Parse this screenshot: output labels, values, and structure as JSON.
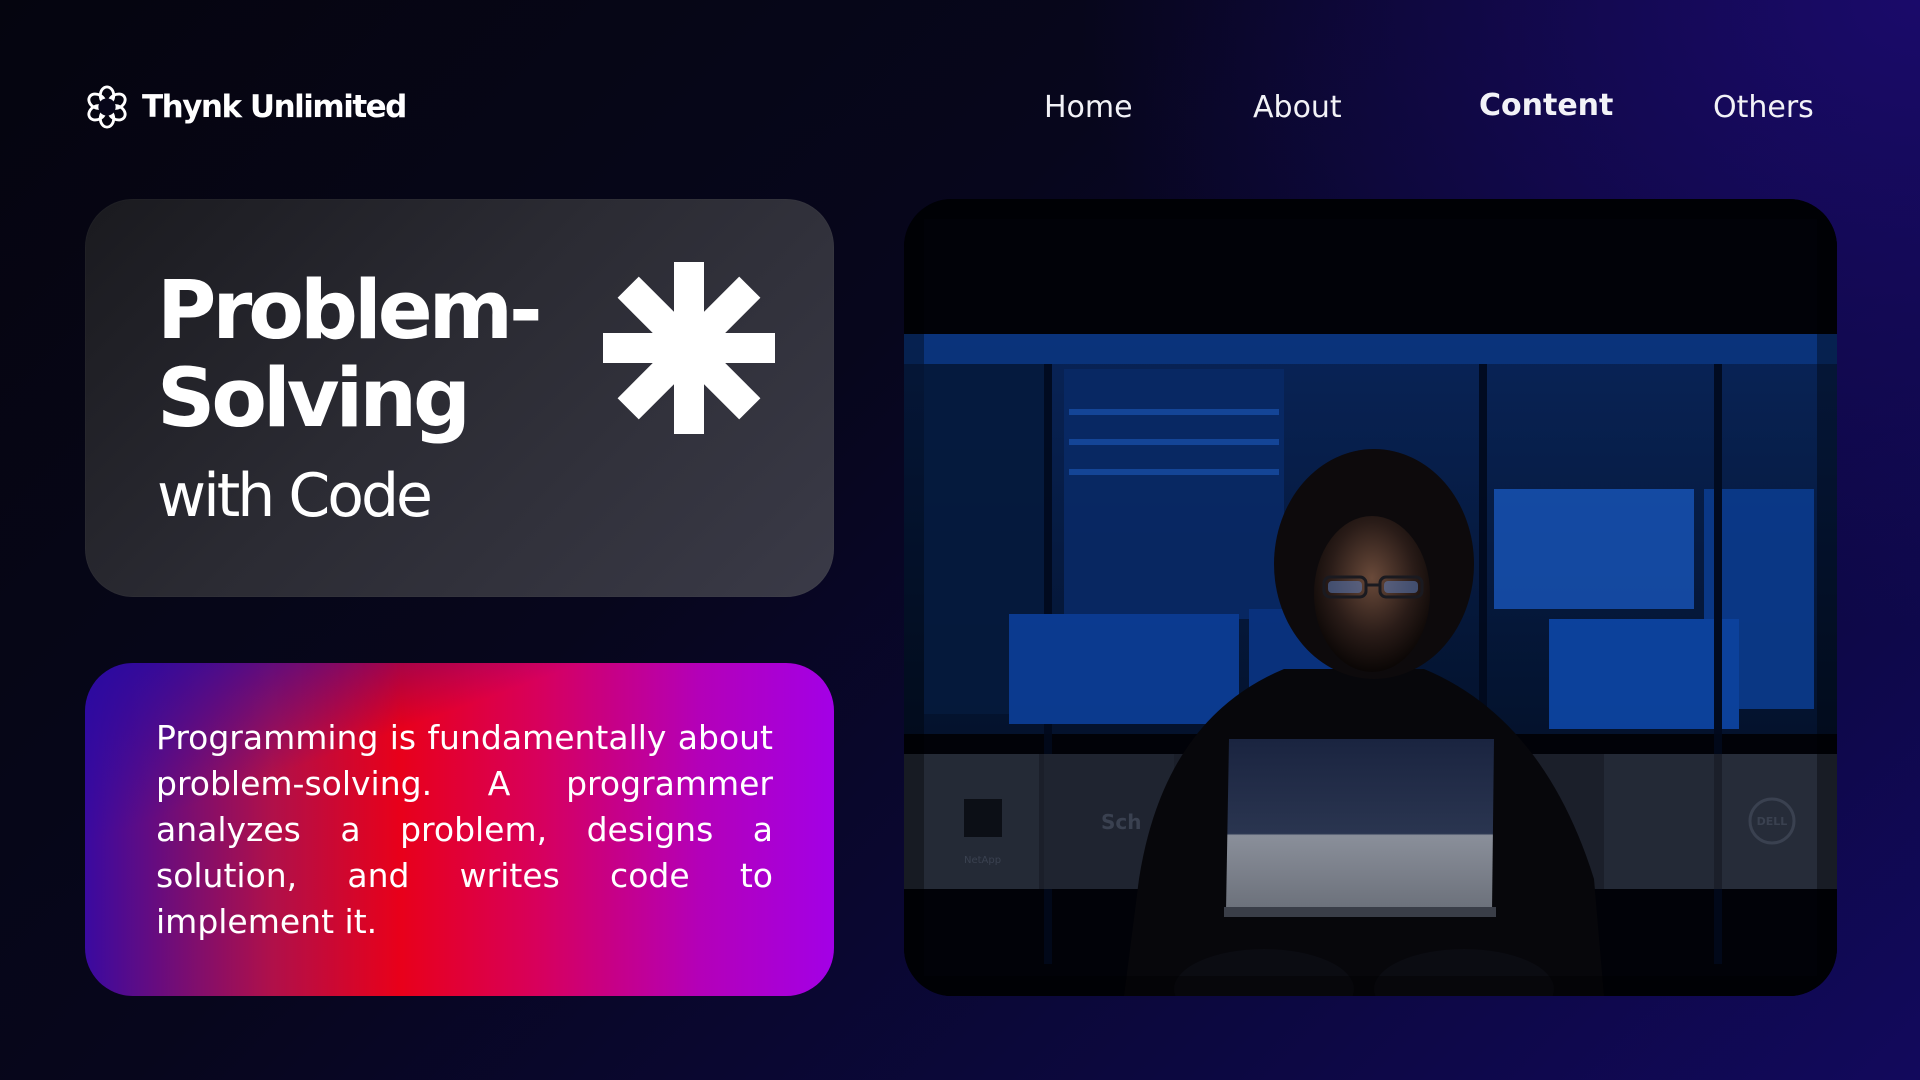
{
  "brand": {
    "name": "Thynk Unlimited",
    "logo_icon": "flower-outline-icon"
  },
  "nav": {
    "items": [
      {
        "label": "Home",
        "active": false
      },
      {
        "label": "About",
        "active": false
      },
      {
        "label": "Content",
        "active": true
      },
      {
        "label": "Others",
        "active": false
      }
    ]
  },
  "hero": {
    "title": "Problem-Solving",
    "subtitle": "with Code",
    "decoration_icon": "asterisk-icon"
  },
  "description": {
    "text": "Programming is fundamentally about problem-solving. A programmer analyzes a problem, designs a solution, and writes code to implement it."
  },
  "photo": {
    "subject": "person-with-laptop-in-dark-server-room",
    "rack_labels": [
      "NetApp",
      "Sch",
      "DELL"
    ]
  },
  "colors": {
    "background_dark": "#05050f",
    "background_blue": "#12095c",
    "title_card": "#2b2b33",
    "gradient_red": "#e8001a",
    "gradient_purple": "#a300e6",
    "text": "#ffffff"
  }
}
